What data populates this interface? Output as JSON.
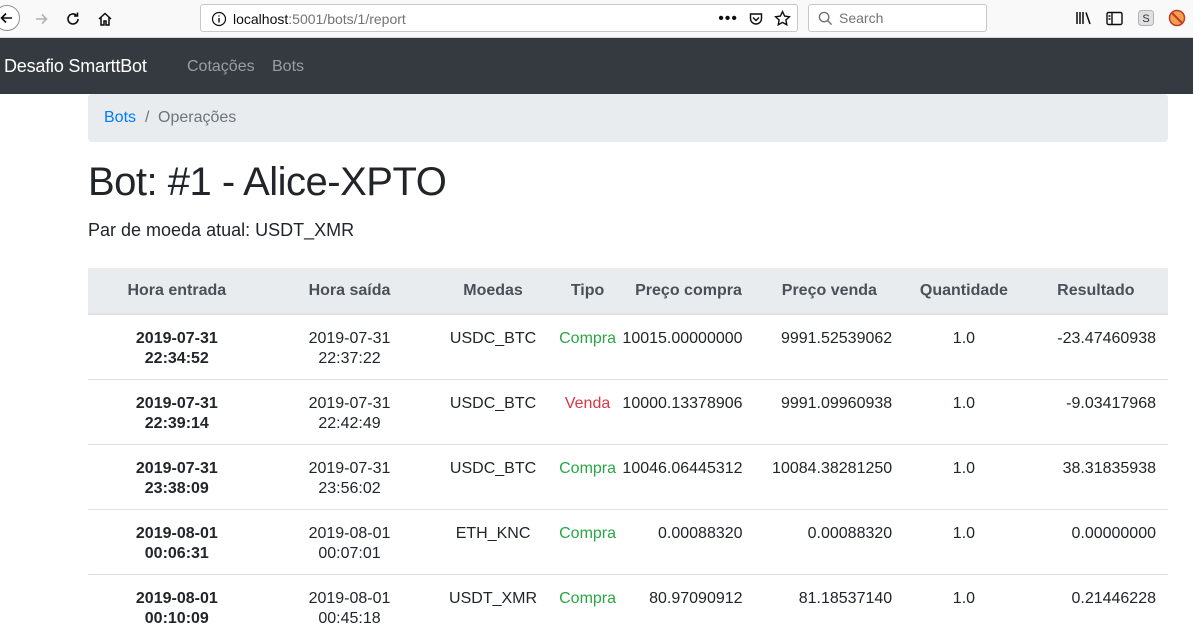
{
  "browser": {
    "url_host": "localhost",
    "url_path": ":5001/bots/1/report",
    "search_placeholder": "Search"
  },
  "navbar": {
    "brand": "Desafio SmarttBot",
    "links": [
      "Cotações",
      "Bots"
    ]
  },
  "breadcrumb": {
    "items": [
      "Bots",
      "Operações"
    ],
    "separator": "/"
  },
  "page": {
    "title": "Bot: #1 - Alice-XPTO",
    "subtitle": "Par de moeda atual: USDT_XMR"
  },
  "table": {
    "headers": [
      "Hora entrada",
      "Hora saída",
      "Moedas",
      "Tipo",
      "Preço compra",
      "Preço venda",
      "Quantidade",
      "Resultado"
    ],
    "rows": [
      {
        "entrada_date": "2019-07-31",
        "entrada_time": "22:34:52",
        "saida_date": "2019-07-31",
        "saida_time": "22:37:22",
        "moedas": "USDC_BTC",
        "tipo": "Compra",
        "preco_compra": "10015.00000000",
        "preco_venda": "9991.52539062",
        "quantidade": "1.0",
        "resultado": "-23.47460938"
      },
      {
        "entrada_date": "2019-07-31",
        "entrada_time": "22:39:14",
        "saida_date": "2019-07-31",
        "saida_time": "22:42:49",
        "moedas": "USDC_BTC",
        "tipo": "Venda",
        "preco_compra": "10000.13378906",
        "preco_venda": "9991.09960938",
        "quantidade": "1.0",
        "resultado": "-9.03417968"
      },
      {
        "entrada_date": "2019-07-31",
        "entrada_time": "23:38:09",
        "saida_date": "2019-07-31",
        "saida_time": "23:56:02",
        "moedas": "USDC_BTC",
        "tipo": "Compra",
        "preco_compra": "10046.06445312",
        "preco_venda": "10084.38281250",
        "quantidade": "1.0",
        "resultado": "38.31835938"
      },
      {
        "entrada_date": "2019-08-01",
        "entrada_time": "00:06:31",
        "saida_date": "2019-08-01",
        "saida_time": "00:07:01",
        "moedas": "ETH_KNC",
        "tipo": "Compra",
        "preco_compra": "0.00088320",
        "preco_venda": "0.00088320",
        "quantidade": "1.0",
        "resultado": "0.00000000"
      },
      {
        "entrada_date": "2019-08-01",
        "entrada_time": "00:10:09",
        "saida_date": "2019-08-01",
        "saida_time": "00:45:18",
        "moedas": "USDT_XMR",
        "tipo": "Compra",
        "preco_compra": "80.97090912",
        "preco_venda": "81.18537140",
        "quantidade": "1.0",
        "resultado": "0.21446228"
      }
    ]
  },
  "colors": {
    "navbar_bg": "#343a40",
    "compra": "#28a745",
    "venda": "#dc3545",
    "link": "#007bff"
  }
}
